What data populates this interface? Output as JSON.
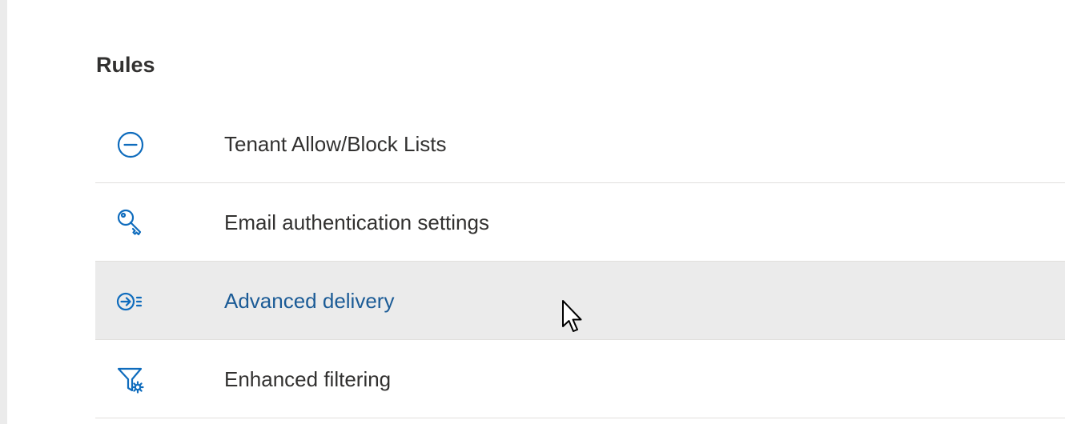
{
  "section": {
    "title": "Rules"
  },
  "rules": {
    "items": [
      {
        "label": "Tenant Allow/Block Lists",
        "icon": "blocked-circle-icon",
        "state": "default"
      },
      {
        "label": "Email authentication settings",
        "icon": "key-icon",
        "state": "default"
      },
      {
        "label": "Advanced delivery",
        "icon": "arrow-circle-list-icon",
        "state": "hover"
      },
      {
        "label": "Enhanced filtering",
        "icon": "filter-settings-icon",
        "state": "default"
      }
    ]
  },
  "colors": {
    "icon_blue": "#0f6cbd",
    "hover_background": "#ebebeb",
    "hover_text": "#1b5b96",
    "text": "#323130",
    "divider": "#e1dfdd"
  }
}
